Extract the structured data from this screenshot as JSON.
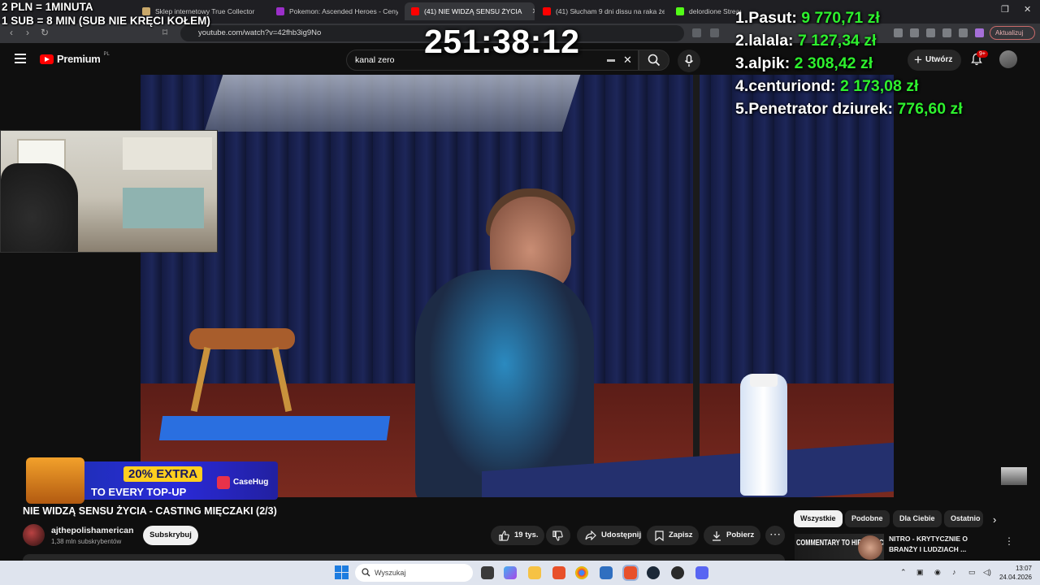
{
  "browser": {
    "tabs": [
      {
        "label": "Sklep internetowy True Collector",
        "active": false
      },
      {
        "label": "Pokemon: Ascended Heroes - Ceny i",
        "active": false
      },
      {
        "label": "(41) NIE WIDZĄ SENSU ŻYCIA",
        "active": true
      },
      {
        "label": "(41) Słucham 9 dni dissu na raka żeb",
        "active": false
      },
      {
        "label": "delordione Stream - Watch Live on K",
        "active": false
      }
    ],
    "url": "youtube.com/watch?v=42fhb3ig9No",
    "update_button": "Aktualizuj"
  },
  "youtube": {
    "logo_text": "Premium",
    "logo_region": "PL",
    "search_value": "kanal zero",
    "create_label": "Utwórz",
    "notification_count": "9+"
  },
  "stream_overlay": {
    "rate_line1": "2 PLN = 1MINUTA",
    "rate_line2": "1 SUB = 8 MIN (SUB NIE KRĘCI KOŁEM)",
    "timer": "251:38:12",
    "leaderboard": [
      {
        "rank": "1.",
        "name": "Pasut:",
        "amount": "9 770,71 zł"
      },
      {
        "rank": "2.",
        "name": "lalala:",
        "amount": "7 127,34 zł"
      },
      {
        "rank": "3.",
        "name": "alpik:",
        "amount": "2 308,42 zł"
      },
      {
        "rank": "4.",
        "name": "centuriond:",
        "amount": "2 173,08 zł"
      },
      {
        "rank": "5.",
        "name": "Penetrator dziurek:",
        "amount": "776,60 zł"
      }
    ],
    "ad": {
      "extra": "20% EXTRA",
      "topup": "TO EVERY TOP-UP",
      "brand": "CaseHug"
    }
  },
  "video": {
    "title": "NIE WIDZĄ SENSU ŻYCIA - CASTING MIĘCZAKI (2/3)",
    "channel_name": "ajthepolishamerican",
    "channel_subs": "1,38 mln subskrybentów",
    "subscribe_label": "Subskrybuj",
    "likes": "19 tys.",
    "share_label": "Udostępnij",
    "save_label": "Zapisz",
    "download_label": "Pobierz"
  },
  "sidebar": {
    "chips": [
      "Wszystkie",
      "Podobne",
      "Dla Ciebie",
      "Ostatnio"
    ],
    "recommendation": {
      "thumb_text": "COMMENTARY TO HIPOKRYCI",
      "title_line1": "NITRO - KRYTYCZNIE O",
      "title_line2": "BRANŻY I LUDZIACH ..."
    }
  },
  "taskbar": {
    "search_placeholder": "Wyszukaj",
    "time": "13:07",
    "date": "24.04.2026"
  }
}
